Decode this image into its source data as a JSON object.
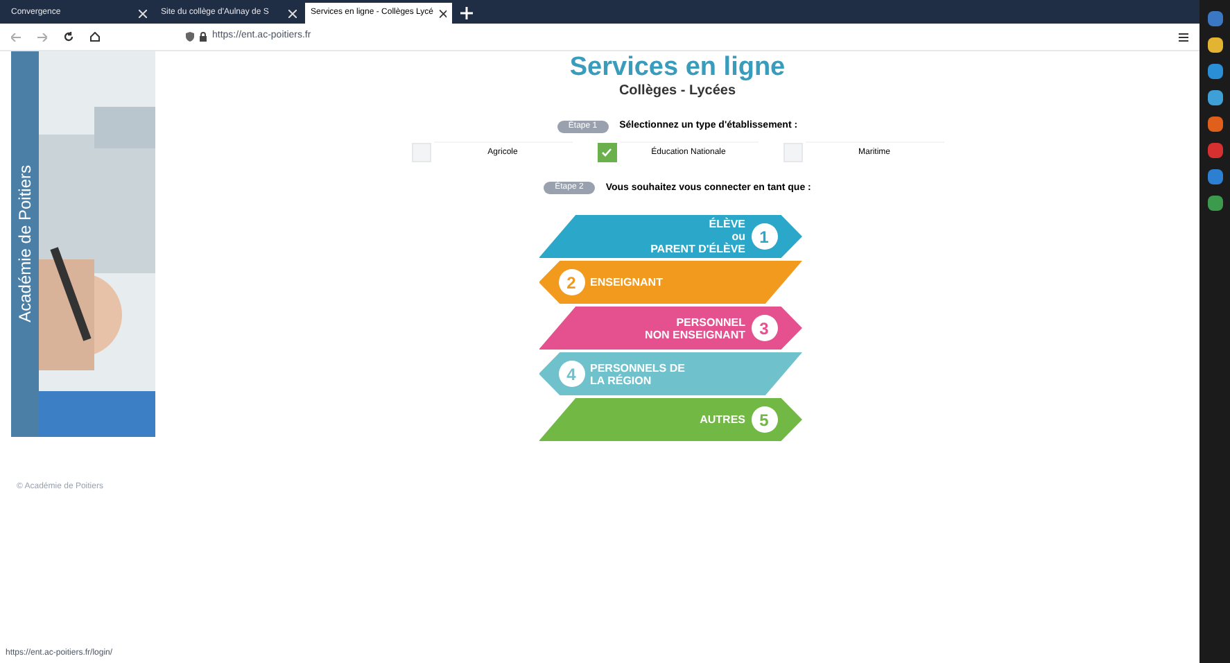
{
  "browser": {
    "tabs": [
      {
        "title": "Convergence",
        "selected": false
      },
      {
        "title": "Site du collège d'Aulnay de S",
        "selected": false
      },
      {
        "title": "Services en ligne - Collèges Lycé",
        "selected": true
      }
    ],
    "url": "https://ent.ac-poitiers.fr"
  },
  "sidebar": {
    "title": "Académie de Poitiers"
  },
  "header": {
    "title": "Services en ligne",
    "subtitle": "Collèges - Lycées"
  },
  "step1": {
    "badge": "Étape 1",
    "question": "Sélectionnez un type d'établissement :",
    "options": [
      {
        "label": "Agricole",
        "checked": false
      },
      {
        "label": "Éducation Nationale",
        "checked": true
      },
      {
        "label": "Maritime",
        "checked": false
      }
    ]
  },
  "step2": {
    "badge": "Étape 2",
    "question": "Vous souhaitez vous connecter en tant que :"
  },
  "profiles": [
    {
      "number": "1",
      "lines": [
        "ÉLÈVE",
        "ou",
        "PARENT D'ÉLÈVE"
      ],
      "color": "#2aa7c9",
      "kind": "right"
    },
    {
      "number": "2",
      "lines": [
        "ENSEIGNANT"
      ],
      "color": "#f29a1d",
      "kind": "left"
    },
    {
      "number": "3",
      "lines": [
        "PERSONNEL",
        "NON ENSEIGNANT"
      ],
      "color": "#e5508f",
      "kind": "right"
    },
    {
      "number": "4",
      "lines": [
        "PERSONNELS DE",
        "LA RÉGION"
      ],
      "color": "#6fc1cc",
      "kind": "left"
    },
    {
      "number": "5",
      "lines": [
        "AUTRES"
      ],
      "color": "#72b844",
      "kind": "right"
    }
  ],
  "footer": "© Académie de Poitiers",
  "status_bar": "https://ent.ac-poitiers.fr/login/"
}
